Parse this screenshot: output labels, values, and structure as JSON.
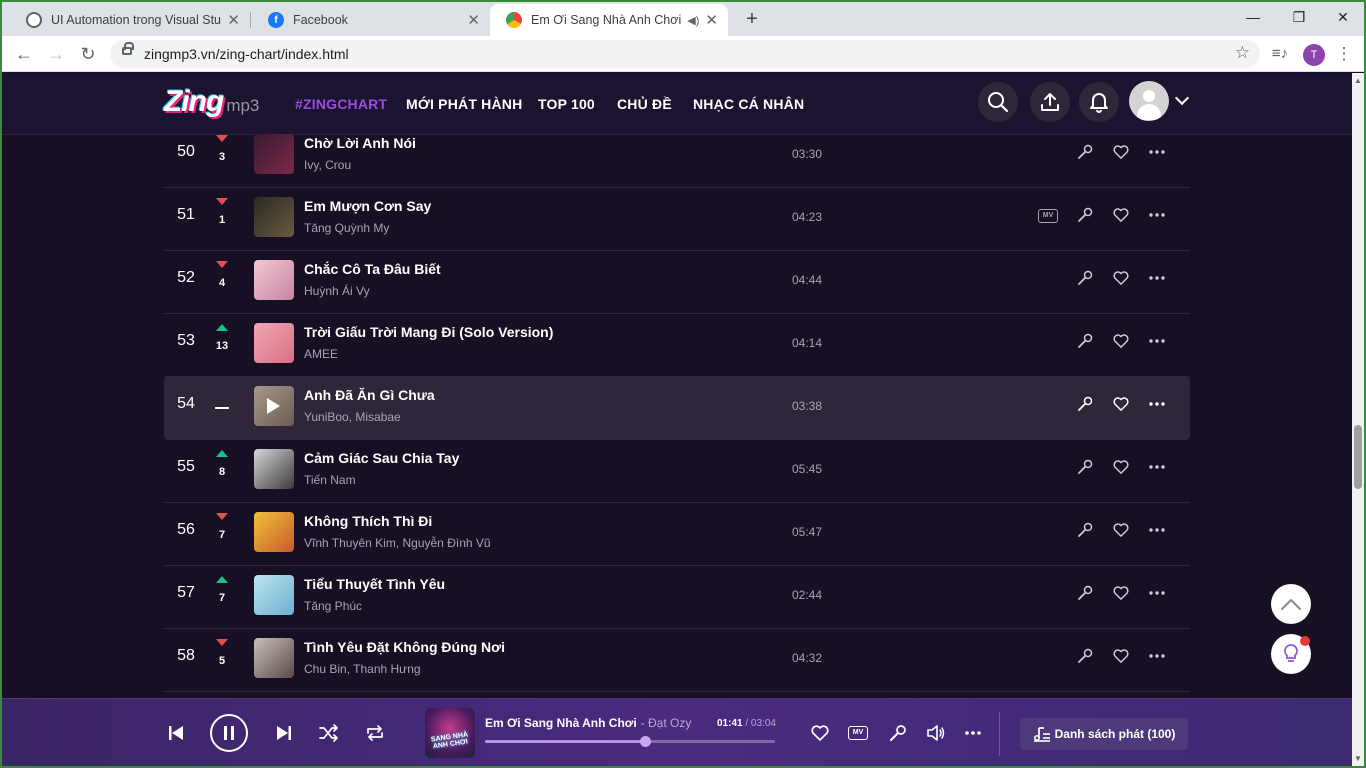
{
  "browser": {
    "tabs": [
      {
        "title": "UI Automation trong Visual Studio",
        "favicon_color": "#5f6368",
        "active": false
      },
      {
        "title": "Facebook",
        "favicon_color": "#1877f2",
        "active": false
      },
      {
        "title": "Em Ơi Sang Nhà Anh Chơi - Đ",
        "favicon_color": "#e8453c",
        "active": true
      }
    ],
    "url": "zingmp3.vn/zing-chart/index.html",
    "profile_initial": "T"
  },
  "site": {
    "logo_text": "Zing",
    "logo_suffix": "mp3",
    "nav": [
      "#ZINGCHART",
      "MỚI PHÁT HÀNH",
      "TOP 100",
      "CHỦ ĐỀ",
      "NHẠC CÁ NHÂN"
    ],
    "accent_color": "#9b4de0",
    "songs": [
      {
        "rank": "50",
        "trend": "down",
        "change": "3",
        "title": "Chờ Lời Anh Nói",
        "artist": "Ivy, Crou",
        "duration": "03:30",
        "mv": false,
        "cover": [
          "#3a1a2e",
          "#7a2a4a"
        ]
      },
      {
        "rank": "51",
        "trend": "down",
        "change": "1",
        "title": "Em Mượn Cơn Say",
        "artist": "Tăng Quỳnh My",
        "duration": "04:23",
        "mv": true,
        "mv_label": "MV",
        "cover": [
          "#2a2a22",
          "#6a5a40"
        ]
      },
      {
        "rank": "52",
        "trend": "down",
        "change": "4",
        "title": "Chắc Cô Ta Đâu Biết",
        "artist": "Huỳnh Ái Vy",
        "duration": "04:44",
        "mv": false,
        "cover": [
          "#f2c8d8",
          "#c8849e"
        ]
      },
      {
        "rank": "53",
        "trend": "up",
        "change": "13",
        "title": "Trời Giấu Trời Mang Đi (Solo Version)",
        "artist": "AMEE",
        "duration": "04:14",
        "mv": false,
        "cover": [
          "#f1a7b3",
          "#d86f86"
        ]
      },
      {
        "rank": "54",
        "trend": "same",
        "change": "",
        "title": "Anh Đã Ăn Gì Chưa",
        "artist": "YuniBoo, Misabae",
        "duration": "03:38",
        "mv": false,
        "cover": [
          "#a89a8a",
          "#6a5c50"
        ]
      },
      {
        "rank": "55",
        "trend": "up",
        "change": "8",
        "title": "Cảm Giác Sau Chia Tay",
        "artist": "Tiến Nam",
        "duration": "05:45",
        "mv": false,
        "cover": [
          "#d8d8d8",
          "#3a3a3a"
        ]
      },
      {
        "rank": "56",
        "trend": "down",
        "change": "7",
        "title": "Không Thích Thì Đi",
        "artist": "Vĩnh Thuyên Kim, Nguyễn Đình Vũ",
        "duration": "05:47",
        "mv": false,
        "cover": [
          "#f0c23a",
          "#c85a2a"
        ]
      },
      {
        "rank": "57",
        "trend": "up",
        "change": "7",
        "title": "Tiểu Thuyết Tình Yêu",
        "artist": "Tăng Phúc",
        "duration": "02:44",
        "mv": false,
        "cover": [
          "#bfe4f0",
          "#6ab0d0"
        ]
      },
      {
        "rank": "58",
        "trend": "down",
        "change": "5",
        "title": "Tình Yêu Đặt Không Đúng Nơi",
        "artist": "Chu Bin, Thanh Hưng",
        "duration": "04:32",
        "mv": false,
        "cover": [
          "#c8c0b8",
          "#5a4a48"
        ]
      }
    ],
    "hover_index": 4
  },
  "player": {
    "title": "Em Ơi Sang Nhà Anh Chơi",
    "artist": "- Đạt Ozy",
    "current_time": "01:41",
    "total_time": "/ 03:04",
    "progress": 0.55,
    "cover_text": "SANG NHÀ ANH CHƠI",
    "playlist_label": "Danh sách phát (100)"
  }
}
